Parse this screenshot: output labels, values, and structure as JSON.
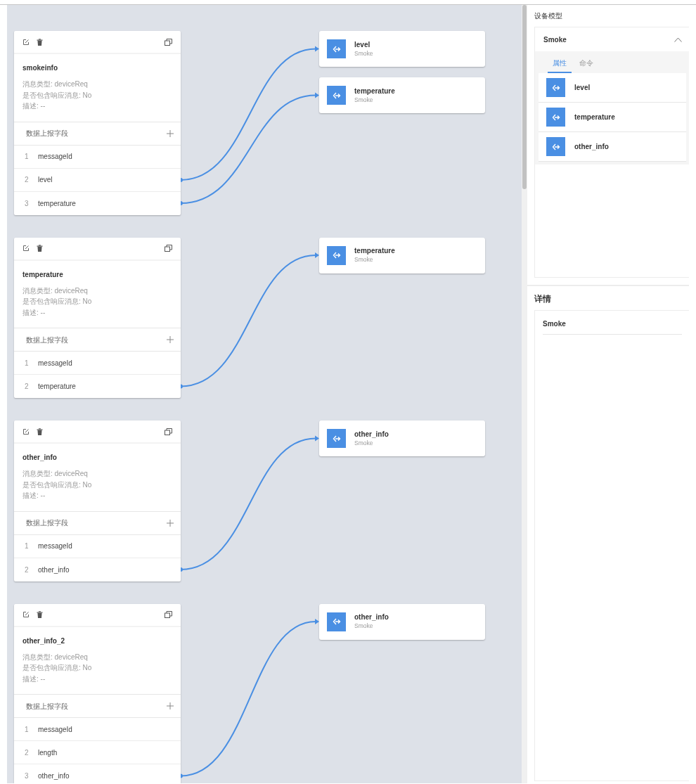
{
  "groups": [
    {
      "message": {
        "title": "smokeinfo",
        "info": [
          "消息类型: deviceReq",
          "是否包含响应消息: No",
          "描述: --"
        ],
        "fields_header": "数据上报字段",
        "fields": [
          {
            "number": "1",
            "name": "messageId",
            "linked": false
          },
          {
            "number": "2",
            "name": "level",
            "linked": true
          },
          {
            "number": "3",
            "name": "temperature",
            "linked": true
          }
        ]
      },
      "targets": [
        {
          "name": "level",
          "device": "Smoke"
        },
        {
          "name": "temperature",
          "device": "Smoke"
        }
      ]
    },
    {
      "message": {
        "title": "temperature",
        "info": [
          "消息类型: deviceReq",
          "是否包含响应消息: No",
          "描述: --"
        ],
        "fields_header": "数据上报字段",
        "fields": [
          {
            "number": "1",
            "name": "messageId",
            "linked": false
          },
          {
            "number": "2",
            "name": "temperature",
            "linked": true
          }
        ]
      },
      "targets": [
        {
          "name": "temperature",
          "device": "Smoke"
        }
      ]
    },
    {
      "message": {
        "title": "other_info",
        "info": [
          "消息类型: deviceReq",
          "是否包含响应消息: No",
          "描述: --"
        ],
        "fields_header": "数据上报字段",
        "fields": [
          {
            "number": "1",
            "name": "messageId",
            "linked": false
          },
          {
            "number": "2",
            "name": "other_info",
            "linked": true
          }
        ]
      },
      "targets": [
        {
          "name": "other_info",
          "device": "Smoke"
        }
      ]
    },
    {
      "message": {
        "title": "other_info_2",
        "info": [
          "消息类型: deviceReq",
          "是否包含响应消息: No",
          "描述: --"
        ],
        "fields_header": "数据上报字段",
        "fields": [
          {
            "number": "1",
            "name": "messageId",
            "linked": false
          },
          {
            "number": "2",
            "name": "length",
            "linked": false
          },
          {
            "number": "3",
            "name": "other_info",
            "linked": true
          }
        ]
      },
      "targets": [
        {
          "name": "other_info",
          "device": "Smoke"
        }
      ]
    }
  ],
  "device_model": {
    "title": "设备模型",
    "device": "Smoke",
    "expanded": true,
    "tabs": [
      {
        "label": "属性",
        "selected": true
      },
      {
        "label": "命令",
        "selected": false
      }
    ],
    "properties": [
      "level",
      "temperature",
      "other_info"
    ]
  },
  "details": {
    "title": "详情",
    "device": "Smoke"
  }
}
